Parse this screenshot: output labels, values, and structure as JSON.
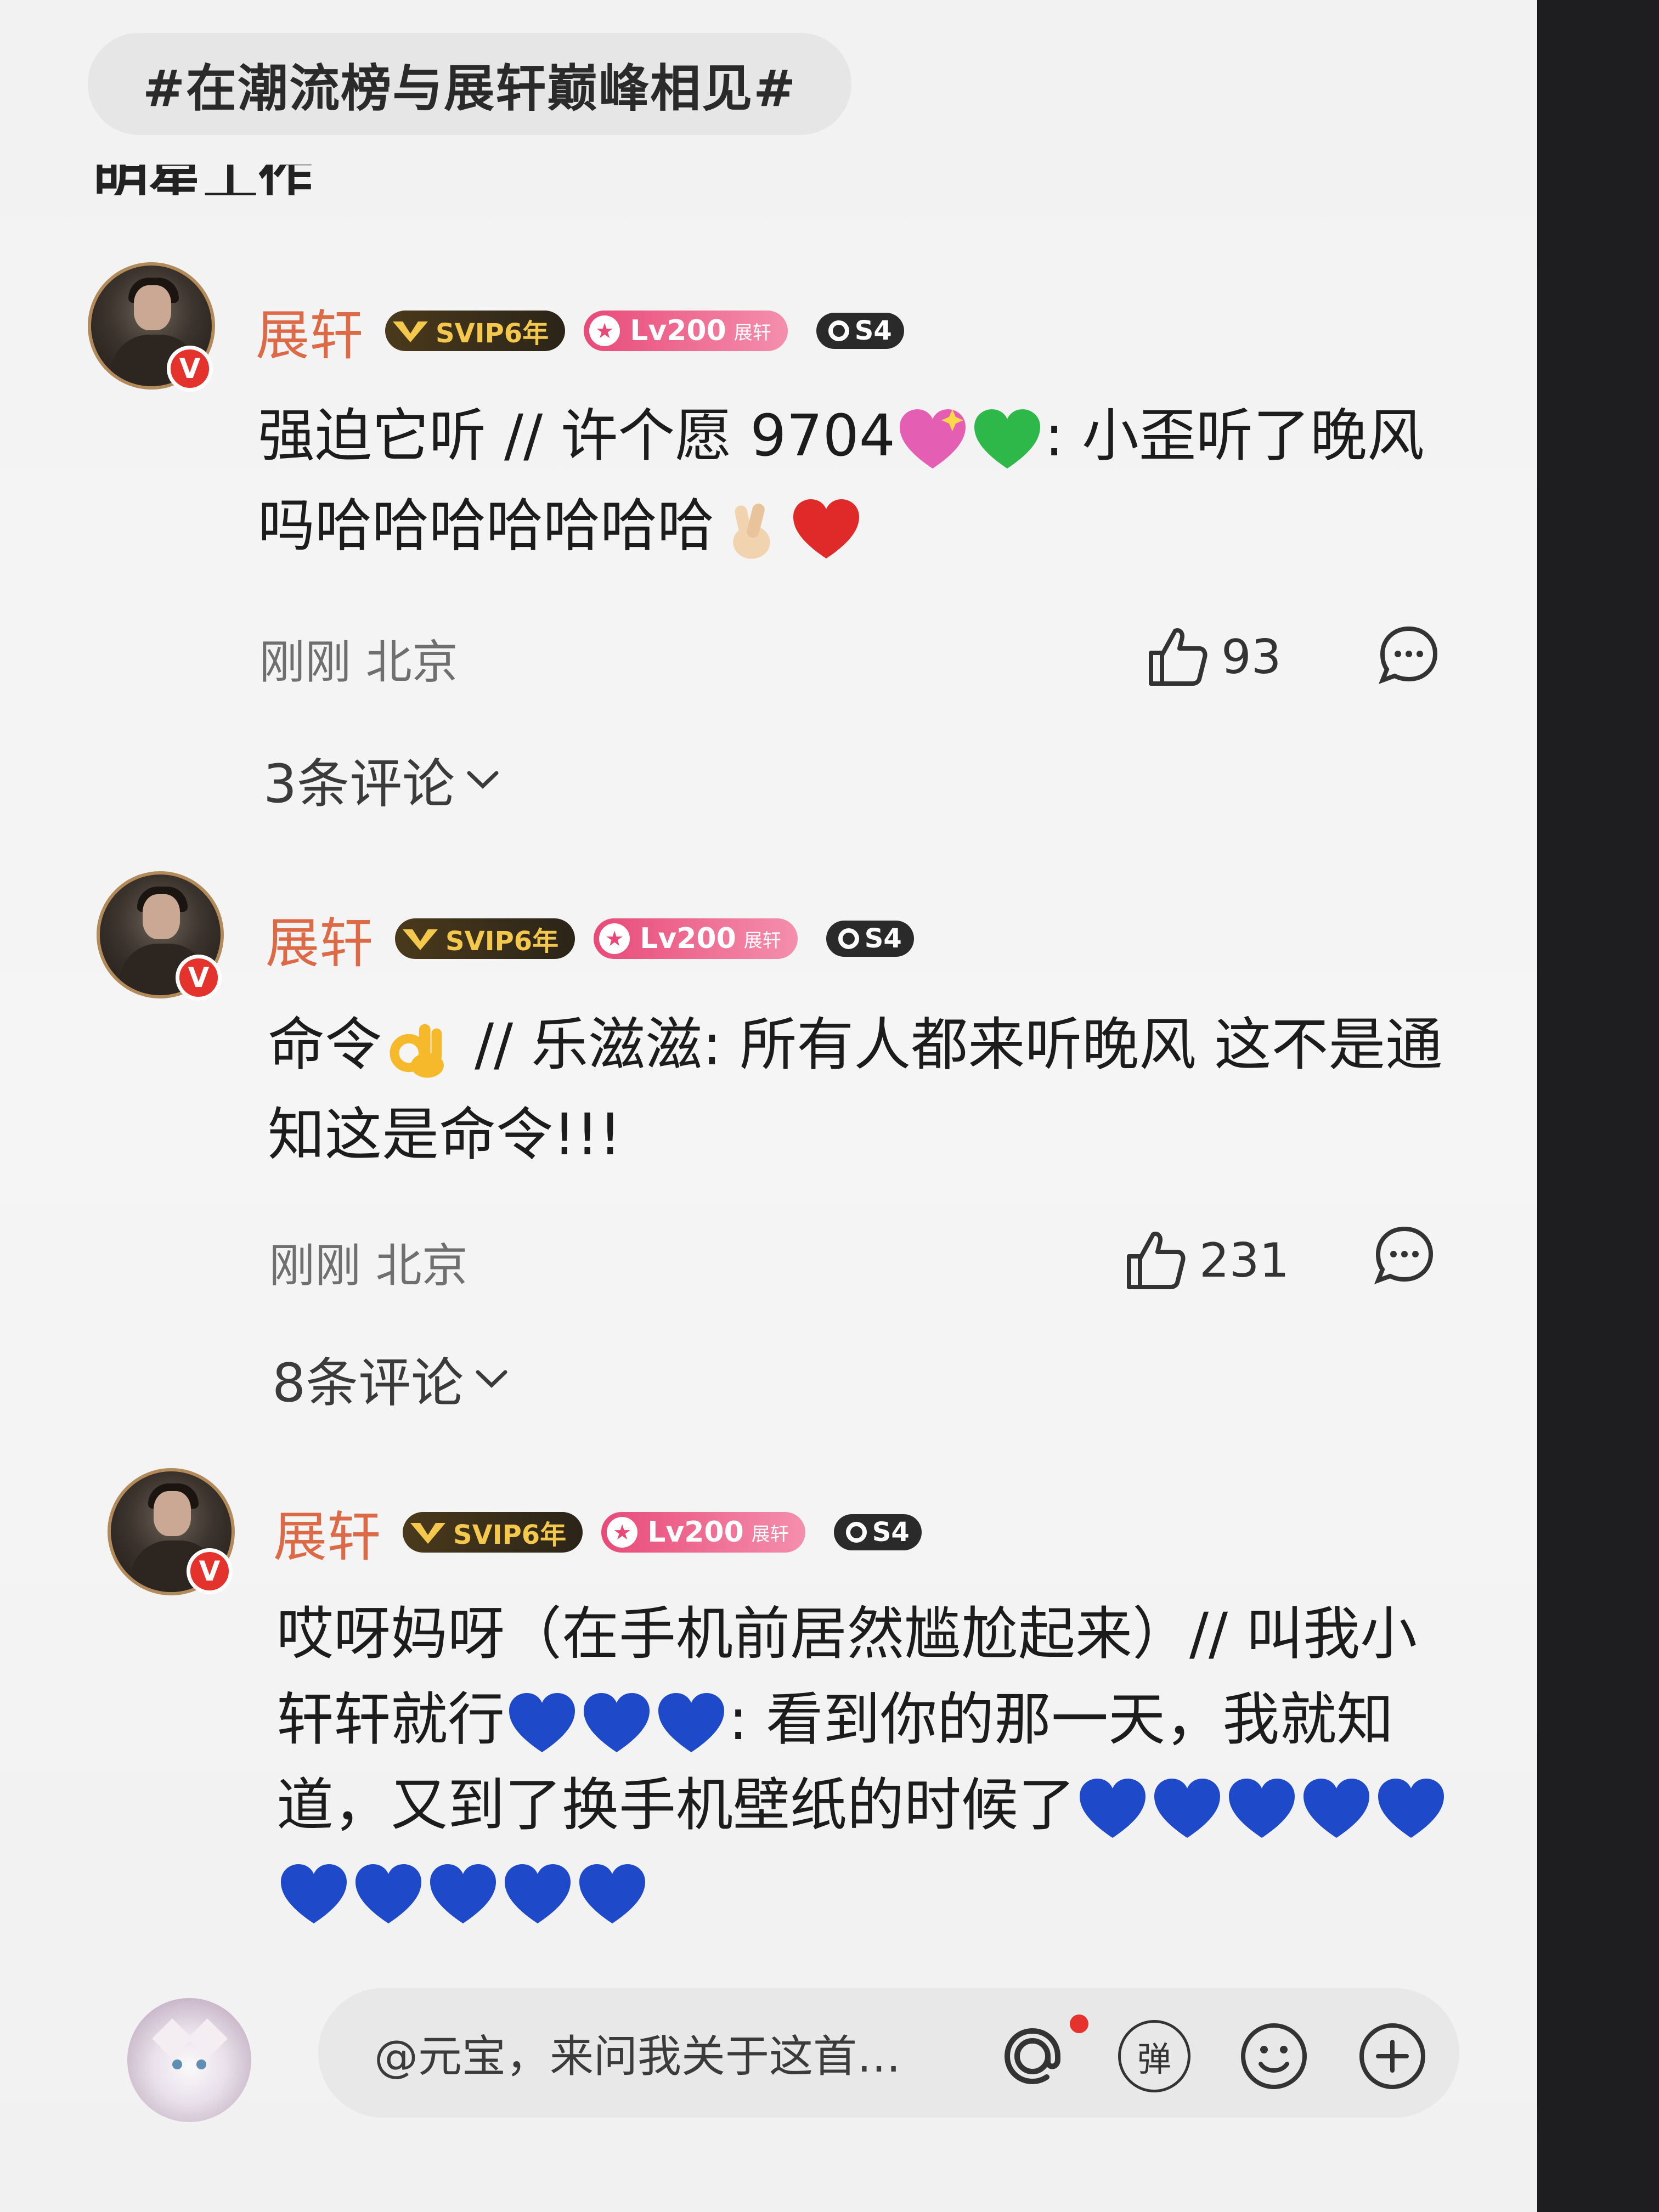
{
  "topic_pill": "#在潮流榜与展轩巅峰相见#",
  "clipped_header": "明星工作",
  "comments": [
    {
      "username": "展轩",
      "svip": "SVIP6年",
      "lv": "Lv200",
      "lv_sub": "展轩",
      "season": "S4",
      "text_a": "强迫它听 // 许个愿 9704",
      "text_b": ": 小歪听了晚风吗哈哈哈哈哈哈哈",
      "time_loc": "刚刚 北京",
      "likes": "93",
      "replies": "3条评论"
    },
    {
      "username": "展轩",
      "svip": "SVIP6年",
      "lv": "Lv200",
      "lv_sub": "展轩",
      "season": "S4",
      "text_a": "命令",
      "text_b": " // 乐滋滋: 所有人都来听晚风 这不是通知这是命令!!!",
      "time_loc": "刚刚 北京",
      "likes": "231",
      "replies": "8条评论"
    },
    {
      "username": "展轩",
      "svip": "SVIP6年",
      "lv": "Lv200",
      "lv_sub": "展轩",
      "season": "S4",
      "text_a": "哎呀妈呀（在手机前居然尴尬起来）// 叫我小轩轩就行",
      "text_b": ": 看到你的那一天，我就知道，又到了换手机壁纸的时候了"
    }
  ],
  "input": {
    "placeholder": "@元宝，来问我关于这首…",
    "tools": [
      "at-icon",
      "danmu-icon",
      "emoji-icon",
      "plus-icon"
    ],
    "danmu_label": "弹"
  },
  "colors": {
    "username": "#dd6a47",
    "svip_bg": "#3a2f1c",
    "svip_text": "#f4c74d",
    "lv_bg": "#e84a78",
    "blue_heart": "#1e49c8",
    "red_dot": "#e5322c"
  },
  "icons": [
    "verified-v-icon",
    "crown-icon",
    "star-icon",
    "season-ring-icon",
    "thumbs-up-icon",
    "comment-bubble-icon",
    "chevron-down-icon"
  ]
}
